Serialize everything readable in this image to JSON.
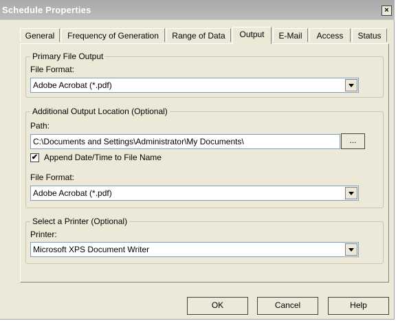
{
  "window": {
    "title": "Schedule Properties",
    "close_label": "×"
  },
  "tabs": [
    {
      "label": "General"
    },
    {
      "label": "Frequency of Generation"
    },
    {
      "label": "Range of Data"
    },
    {
      "label": "Output",
      "active": true
    },
    {
      "label": "E-Mail"
    },
    {
      "label": "Access"
    },
    {
      "label": "Status"
    }
  ],
  "primary": {
    "legend": "Primary File Output",
    "format_label": "File Format:",
    "format_value": "Adobe Acrobat (*.pdf)"
  },
  "additional": {
    "legend": "Additional Output Location (Optional)",
    "path_label": "Path:",
    "path_value": "C:\\Documents and Settings\\Administrator\\My Documents\\",
    "browse_label": "...",
    "append_label": "Append Date/Time to File Name",
    "append_checked": true,
    "check_mark": "✔",
    "format_label": "File Format:",
    "format_value": "Adobe Acrobat (*.pdf)"
  },
  "printer": {
    "legend": "Select a Printer (Optional)",
    "label": "Printer:",
    "value": "Microsoft XPS Document Writer"
  },
  "buttons": {
    "ok": "OK",
    "cancel": "Cancel",
    "help": "Help"
  }
}
